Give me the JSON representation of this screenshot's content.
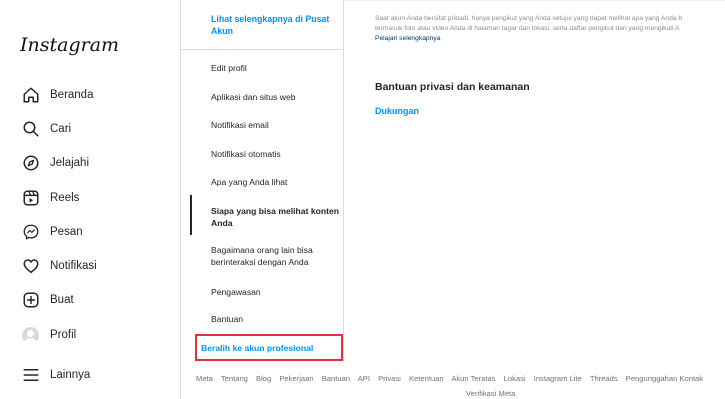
{
  "app": {
    "logo": "Instagram"
  },
  "nav": {
    "items": [
      {
        "label": "Beranda",
        "icon": "home-icon"
      },
      {
        "label": "Cari",
        "icon": "search-icon"
      },
      {
        "label": "Jelajahi",
        "icon": "compass-icon"
      },
      {
        "label": "Reels",
        "icon": "reels-icon"
      },
      {
        "label": "Pesan",
        "icon": "messenger-icon"
      },
      {
        "label": "Notifikasi",
        "icon": "heart-icon"
      },
      {
        "label": "Buat",
        "icon": "plus-square-icon"
      },
      {
        "label": "Profil",
        "icon": "avatar-icon"
      },
      {
        "label": "Lainnya",
        "icon": "menu-icon"
      }
    ]
  },
  "settings": {
    "account_center_link": "Lihat selengkapnya di Pusat Akun",
    "menu": [
      "Edit profil",
      "Aplikasi dan situs web",
      "Notifikasi email",
      "Notifikasi otomatis",
      "Apa yang Anda lihat",
      "Siapa yang bisa melihat konten Anda",
      "Bagaimana orang lain bisa berinteraksi dengan Anda",
      "Pengawasan",
      "Bantuan"
    ],
    "active_item": "Siapa yang bisa melihat konten Anda",
    "professional_switch": "Beralih ke akun profesional"
  },
  "main": {
    "privacy_note_line1": "Saat akun Anda bersifat pribadi, hanya pengikut yang Anda setujui yang dapat melihat apa yang Anda b",
    "privacy_note_line2": "termasuk foto atau video Anda di halaman tagar dan lokasi, serta daftar pengikut dan yang mengikuti A",
    "learn_more": "Pelajari selengkapnya",
    "section_title": "Bantuan privasi dan keamanan",
    "support_link": "Dukungan"
  },
  "footer": {
    "links": [
      "Meta",
      "Tentang",
      "Blog",
      "Pekerjaan",
      "Bantuan",
      "API",
      "Privasi",
      "Ketentuan",
      "Akun Teratas",
      "Lokasi",
      "Instagram Lite",
      "Threads",
      "Pengunggahan Kontak"
    ],
    "second_line": "Verifikasi Meta"
  },
  "colors": {
    "link": "#0095f6",
    "highlight_border": "#e0323c",
    "text": "#262626",
    "muted": "#8e8e8e"
  }
}
